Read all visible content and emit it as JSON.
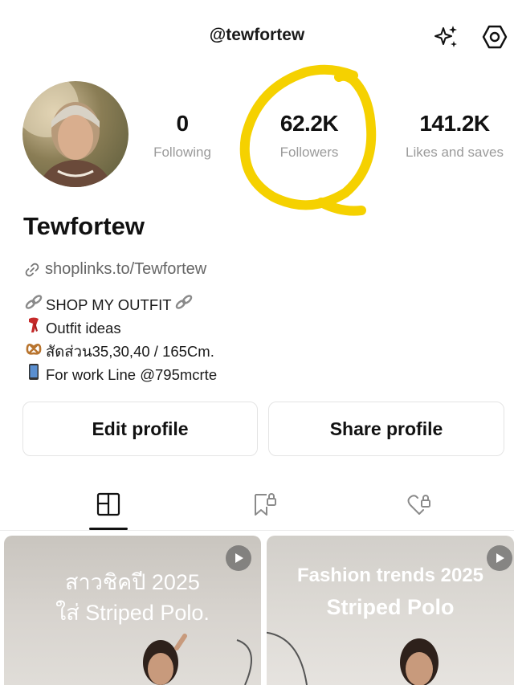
{
  "header": {
    "username": "@tewfortew"
  },
  "profile": {
    "display_name": "Tewfortew",
    "link": "shoplinks.to/Tewfortew"
  },
  "stats": {
    "following": {
      "value": "0",
      "label": "Following"
    },
    "followers": {
      "value": "62.2K",
      "label": "Followers"
    },
    "likes": {
      "value": "141.2K",
      "label": "Likes and saves"
    }
  },
  "bio": [
    {
      "icon": "link-emoji",
      "text": "SHOP MY OUTFIT"
    },
    {
      "icon": "scarf-emoji",
      "text": "Outfit ideas"
    },
    {
      "icon": "pretzel-emoji",
      "text": "สัดส่วน35,30,40 / 165Cm."
    },
    {
      "icon": "phone-emoji",
      "text": "For work Line @795mcrte"
    }
  ],
  "buttons": {
    "edit": "Edit profile",
    "share": "Share profile"
  },
  "posts": [
    {
      "line1": "สาวชิคปี 2025",
      "line2": "ใส่ Striped Polo."
    },
    {
      "line1": "Fashion trends 2025",
      "line2": "Striped Polo"
    }
  ],
  "colors": {
    "annotation": "#f5d100",
    "text_primary": "#111111",
    "text_secondary": "#9a9a9a"
  }
}
